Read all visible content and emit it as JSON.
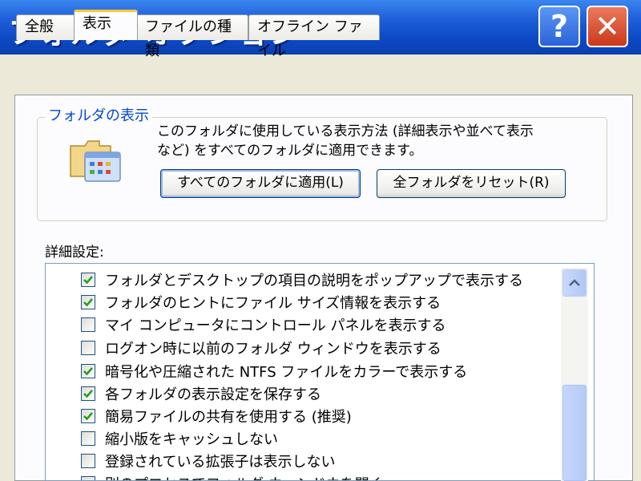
{
  "window": {
    "title": "フォルダ オプション",
    "help_label": "?",
    "close_label": "✕"
  },
  "tabs": [
    {
      "label": "全般",
      "active": false
    },
    {
      "label": "表示",
      "active": true
    },
    {
      "label": "ファイルの種類",
      "active": false
    },
    {
      "label": "オフライン ファイル",
      "active": false
    }
  ],
  "folder_view": {
    "group_title": "フォルダの表示",
    "icon": "folder-views-icon",
    "description_line1": "このフォルダに使用している表示方法 (詳細表示や並べて表示",
    "description_line2": "など) をすべてのフォルダに適用できます。",
    "apply_button": "すべてのフォルダに適用(L)",
    "reset_button": "全フォルダをリセット(R)"
  },
  "advanced": {
    "label": "詳細設定:",
    "items": [
      {
        "label": "フォルダとデスクトップの項目の説明をポップアップで表示する",
        "checked": true
      },
      {
        "label": "フォルダのヒントにファイル サイズ情報を表示する",
        "checked": true
      },
      {
        "label": "マイ コンピュータにコントロール パネルを表示する",
        "checked": false
      },
      {
        "label": "ログオン時に以前のフォルダ ウィンドウを表示する",
        "checked": false
      },
      {
        "label": "暗号化や圧縮された NTFS ファイルをカラーで表示する",
        "checked": true
      },
      {
        "label": "各フォルダの表示設定を保存する",
        "checked": true
      },
      {
        "label": "簡易ファイルの共有を使用する (推奨)",
        "checked": true
      },
      {
        "label": "縮小版をキャッシュしない",
        "checked": false
      },
      {
        "label": "登録されている拡張子は表示しない",
        "checked": false
      },
      {
        "label": "別のプロセスでフォルダ ウィンドウを開く",
        "checked": false
      }
    ]
  },
  "colors": {
    "titlebar": "#0d4ac6",
    "group_title": "#0046d5",
    "check": "#21a121"
  }
}
